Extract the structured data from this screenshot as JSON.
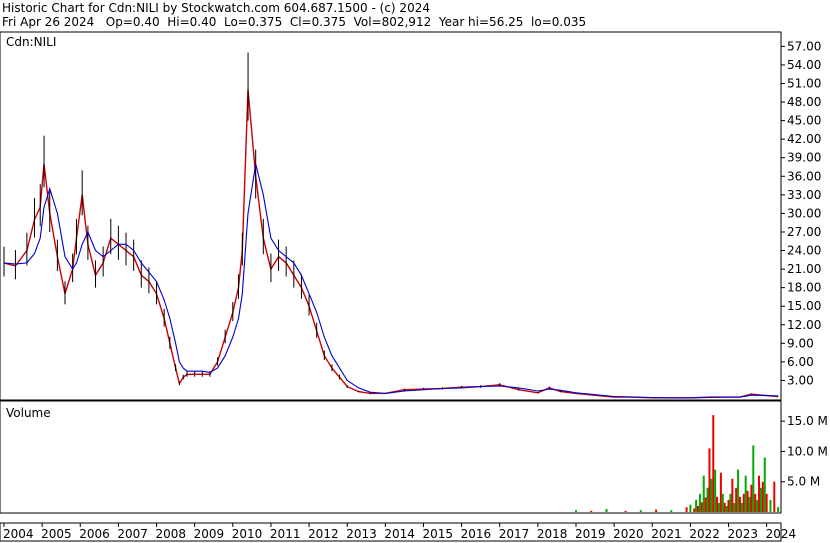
{
  "header": {
    "line1": "Historic Chart for Cdn:NILI by Stockwatch.com 604.687.1500 - (c) 2024",
    "line2": "Fri Apr 26 2024   Op=0.40  Hi=0.40  Lo=0.375  Cl=0.375  Vol=802,912  Year hi=56.25  lo=0.035"
  },
  "chart_data": [
    {
      "type": "line",
      "title": "",
      "symbol_label": "Cdn:NILI",
      "xlabel": "",
      "ylabel": "",
      "x_ticks": [
        "2004",
        "2005",
        "2006",
        "2007",
        "2008",
        "2009",
        "2010",
        "2011",
        "2012",
        "2013",
        "2014",
        "2015",
        "2016",
        "2017",
        "2018",
        "2019",
        "2020",
        "2021",
        "2022",
        "2023",
        "2024"
      ],
      "y_ticks": [
        "57.00",
        "54.00",
        "51.00",
        "48.00",
        "45.00",
        "42.00",
        "39.00",
        "36.00",
        "33.00",
        "30.00",
        "27.00",
        "24.00",
        "21.00",
        "18.00",
        "15.00",
        "12.00",
        "9.00",
        "6.00",
        "3.00"
      ],
      "ylim": [
        0,
        59
      ],
      "grid": false,
      "series": [
        {
          "color": "#cc0000",
          "x": [
            2004.0,
            2004.3,
            2004.6,
            2004.8,
            2004.95,
            2005.05,
            2005.2,
            2005.4,
            2005.6,
            2005.8,
            2005.9,
            2006.05,
            2006.2,
            2006.4,
            2006.6,
            2006.8,
            2007.0,
            2007.2,
            2007.4,
            2007.6,
            2007.8,
            2008.0,
            2008.2,
            2008.35,
            2008.5,
            2008.6,
            2008.7,
            2008.8,
            2009.0,
            2009.2,
            2009.4,
            2009.6,
            2009.8,
            2010.0,
            2010.15,
            2010.25,
            2010.4,
            2010.6,
            2010.8,
            2011.0,
            2011.2,
            2011.4,
            2011.6,
            2011.8,
            2012.0,
            2012.2,
            2012.4,
            2012.6,
            2012.8,
            2013.0,
            2013.3,
            2013.6,
            2014.0,
            2014.5,
            2015.0,
            2015.5,
            2016.0,
            2016.5,
            2017.0,
            2017.5,
            2018.0,
            2018.3,
            2018.6,
            2019.0,
            2019.5,
            2020.0,
            2020.5,
            2021.0,
            2021.5,
            2022.0,
            2022.5,
            2023.0,
            2023.3,
            2023.6,
            2023.9,
            2024.3
          ],
          "values": [
            22,
            21.5,
            24,
            29,
            31,
            38,
            30,
            23,
            17,
            21,
            26,
            33,
            25,
            20,
            22,
            26,
            25,
            24,
            23,
            20,
            19,
            17,
            13,
            9,
            5,
            2.5,
            3.5,
            4,
            4,
            4,
            4,
            6,
            10,
            14,
            18,
            24,
            50,
            36,
            26,
            21,
            23,
            22,
            20,
            18,
            15,
            11,
            7,
            5,
            3.5,
            2,
            1.2,
            0.9,
            0.9,
            1.5,
            1.6,
            1.7,
            1.9,
            2,
            2.3,
            1.5,
            1,
            1.8,
            1.2,
            0.9,
            0.6,
            0.3,
            0.3,
            0.2,
            0.2,
            0.2,
            0.3,
            0.3,
            0.3,
            0.8,
            0.6,
            0.4
          ]
        },
        {
          "color": "#0000cc",
          "x": [
            2004.0,
            2004.3,
            2004.6,
            2004.8,
            2004.95,
            2005.05,
            2005.2,
            2005.4,
            2005.6,
            2005.8,
            2005.9,
            2006.05,
            2006.2,
            2006.4,
            2006.6,
            2006.8,
            2007.0,
            2007.2,
            2007.4,
            2007.6,
            2007.8,
            2008.0,
            2008.2,
            2008.35,
            2008.5,
            2008.6,
            2008.7,
            2008.8,
            2009.0,
            2009.2,
            2009.4,
            2009.6,
            2009.8,
            2010.0,
            2010.15,
            2010.25,
            2010.4,
            2010.6,
            2010.8,
            2011.0,
            2011.2,
            2011.4,
            2011.6,
            2011.8,
            2012.0,
            2012.2,
            2012.4,
            2012.6,
            2012.8,
            2013.0,
            2013.3,
            2013.6,
            2014.0,
            2014.5,
            2015.0,
            2015.5,
            2016.0,
            2016.5,
            2017.0,
            2017.5,
            2018.0,
            2018.3,
            2018.6,
            2019.0,
            2019.5,
            2020.0,
            2020.5,
            2021.0,
            2021.5,
            2022.0,
            2022.5,
            2023.0,
            2023.3,
            2023.6,
            2023.9,
            2024.3
          ],
          "values": [
            22,
            21.8,
            22,
            23.5,
            26,
            31,
            34,
            30,
            23,
            21,
            22,
            25,
            27,
            24,
            23,
            24,
            25,
            25,
            24,
            22,
            20.5,
            19,
            16,
            13,
            9,
            6,
            5,
            4.5,
            4.5,
            4.5,
            4.3,
            5,
            7,
            10,
            13,
            17,
            30,
            38,
            33,
            26,
            24,
            23,
            22,
            20,
            17,
            14,
            10,
            7,
            5,
            3,
            1.8,
            1.1,
            0.9,
            1.3,
            1.5,
            1.7,
            1.8,
            2,
            2.1,
            1.8,
            1.3,
            1.6,
            1.4,
            1,
            0.7,
            0.4,
            0.3,
            0.25,
            0.2,
            0.2,
            0.25,
            0.3,
            0.3,
            0.6,
            0.6,
            0.5
          ]
        }
      ]
    },
    {
      "type": "bar",
      "title": "",
      "panel_label": "Volume",
      "y_ticks": [
        "15.0 M",
        "10.0 M",
        "5.0 M"
      ],
      "ylim": [
        0,
        18
      ],
      "grid": false,
      "series": [
        {
          "colors": [
            "#00aa00",
            "#ee0000"
          ],
          "x": [
            2019.0,
            2019.4,
            2019.8,
            2020.3,
            2020.7,
            2021.1,
            2021.5,
            2021.9,
            2022.0,
            2022.1,
            2022.15,
            2022.2,
            2022.25,
            2022.3,
            2022.35,
            2022.4,
            2022.45,
            2022.5,
            2022.55,
            2022.6,
            2022.65,
            2022.7,
            2022.75,
            2022.8,
            2022.85,
            2022.9,
            2022.95,
            2023.0,
            2023.05,
            2023.1,
            2023.15,
            2023.2,
            2023.25,
            2023.3,
            2023.35,
            2023.4,
            2023.45,
            2023.5,
            2023.55,
            2023.6,
            2023.65,
            2023.7,
            2023.75,
            2023.8,
            2023.85,
            2023.9,
            2023.95,
            2024.0,
            2024.1,
            2024.2,
            2024.3
          ],
          "values": [
            0.3,
            0.2,
            0.5,
            0.2,
            0.3,
            0.4,
            0.3,
            0.8,
            1.2,
            0.6,
            2.0,
            1.0,
            3.0,
            1.6,
            6.0,
            2.4,
            4.0,
            10.5,
            5.5,
            16.0,
            7.0,
            2.5,
            1.5,
            6.5,
            3.0,
            1.5,
            1.0,
            2.0,
            3.0,
            5.5,
            1.5,
            4.0,
            7.0,
            2.5,
            1.5,
            3.0,
            6.0,
            3.5,
            2.5,
            4.5,
            11.0,
            3.0,
            2.0,
            6.0,
            4.0,
            5.0,
            9.0,
            3.0,
            2.0,
            5.0,
            0.8
          ]
        }
      ]
    }
  ]
}
